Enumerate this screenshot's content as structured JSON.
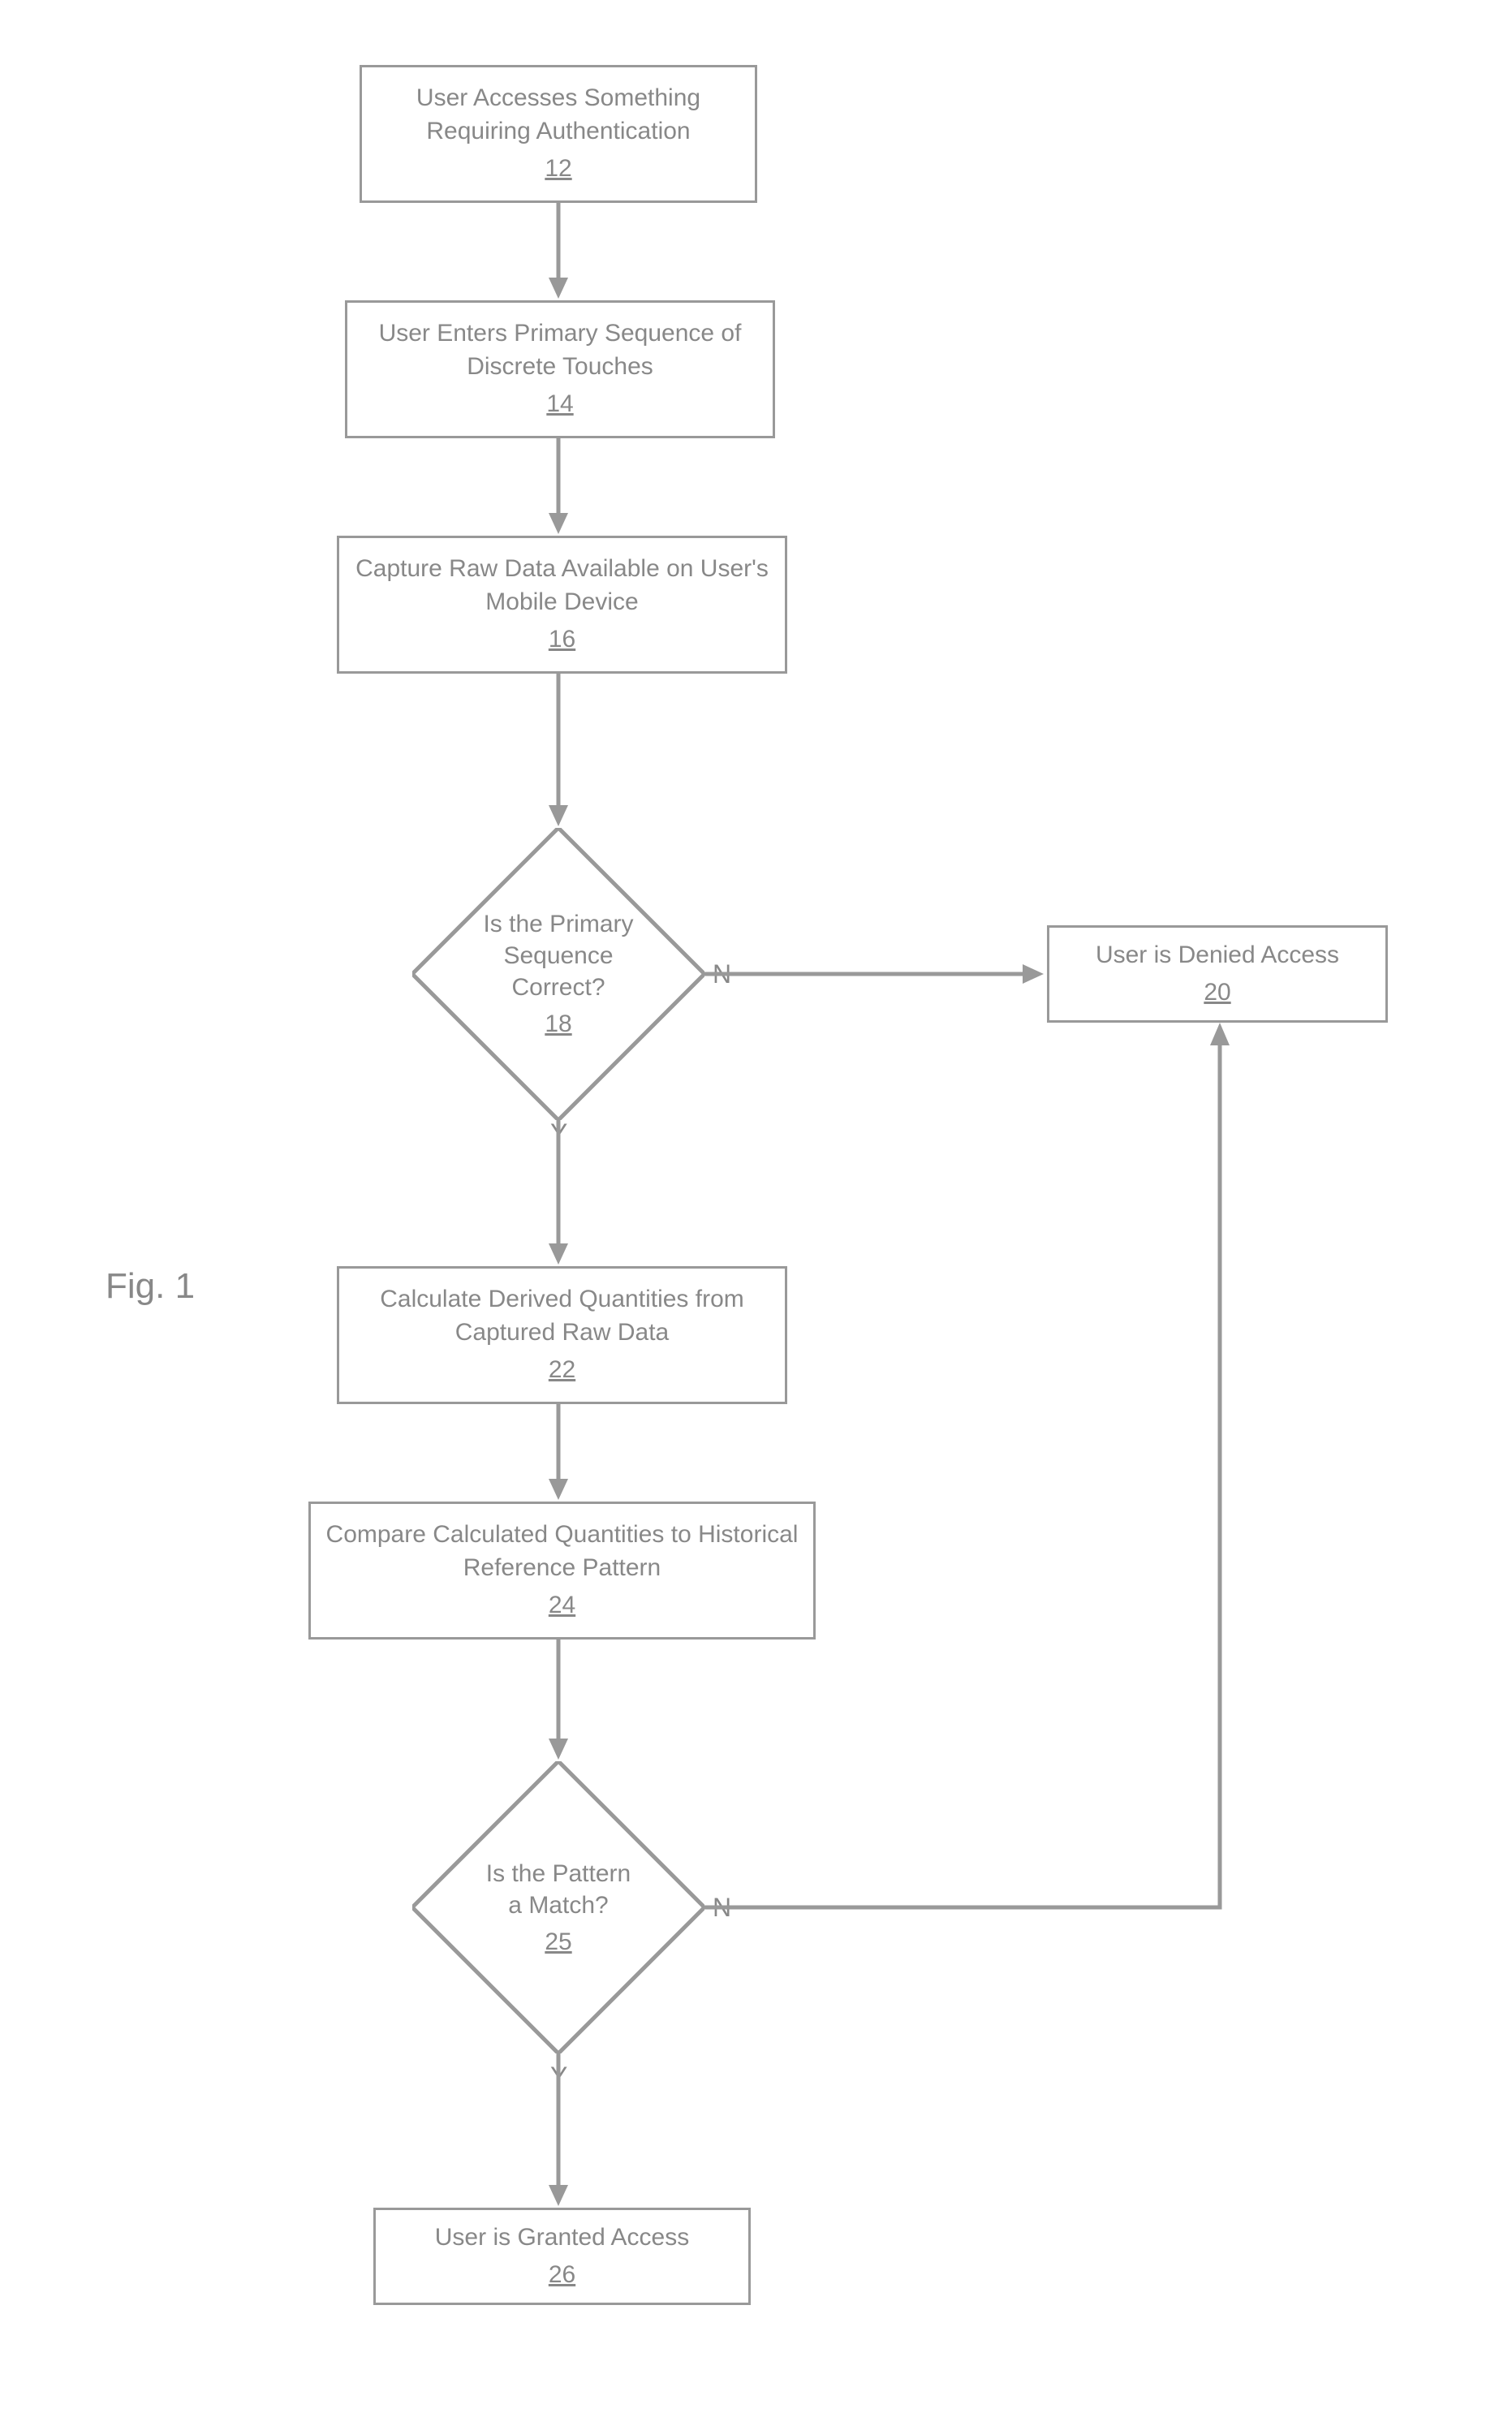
{
  "figure_label": "Fig. 1",
  "yes": "Y",
  "no": "N",
  "nodes": {
    "n12": {
      "text": "User Accesses Something Requiring Authentication",
      "ref": "12"
    },
    "n14": {
      "text": "User Enters Primary Sequence of Discrete Touches",
      "ref": "14"
    },
    "n16": {
      "text": "Capture Raw Data Available on User's Mobile Device",
      "ref": "16"
    },
    "n18": {
      "text": "Is the Primary Sequence Correct?",
      "ref": "18"
    },
    "n20": {
      "text": "User is Denied Access",
      "ref": "20"
    },
    "n22": {
      "text": "Calculate Derived Quantities from Captured Raw Data",
      "ref": "22"
    },
    "n24": {
      "text": "Compare Calculated Quantities to Historical Reference Pattern",
      "ref": "24"
    },
    "n25": {
      "text": "Is the Pattern a Match?",
      "ref": "25"
    },
    "n26": {
      "text": "User is Granted Access",
      "ref": "26"
    }
  }
}
